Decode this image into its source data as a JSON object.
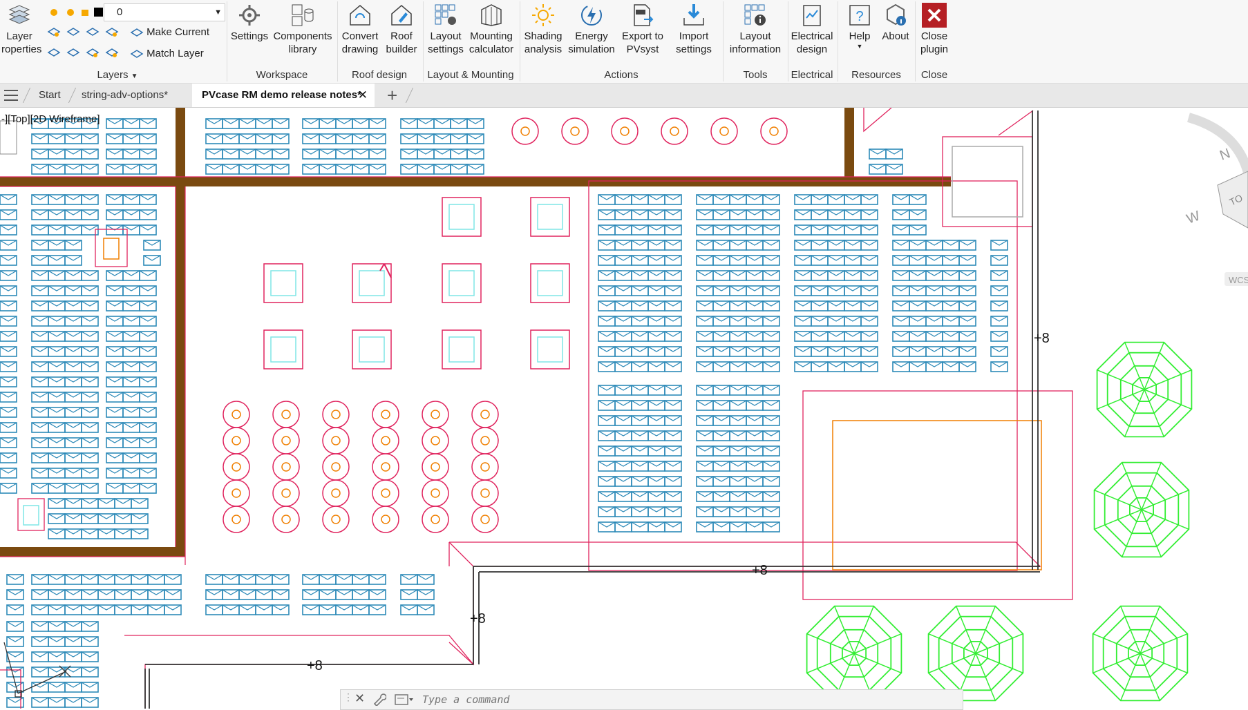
{
  "ribbon": {
    "layers": {
      "layer_properties": "Layer\nroperties",
      "current_layer": "0",
      "make_current": "Make Current",
      "match_layer": "Match Layer",
      "group_label": "Layers"
    },
    "workspace": {
      "settings": "Settings",
      "components_library": "Components\nlibrary",
      "group_label": "Workspace"
    },
    "roof_design": {
      "convert_drawing": "Convert\ndrawing",
      "roof_builder": "Roof\nbuilder",
      "group_label": "Roof design"
    },
    "layout_mounting": {
      "layout_settings": "Layout\nsettings",
      "mounting_calculator": "Mounting\ncalculator",
      "group_label": "Layout & Mounting"
    },
    "actions": {
      "shading_analysis": "Shading\nanalysis",
      "energy_simulation": "Energy\nsimulation",
      "export_to_pvsyst": "Export to\nPVsyst",
      "import_settings": "Import\nsettings",
      "group_label": "Actions"
    },
    "tools": {
      "layout_information": "Layout\ninformation",
      "group_label": "Tools"
    },
    "electrical": {
      "electrical_design": "Electrical\ndesign",
      "group_label": "Electrical"
    },
    "resources": {
      "help": "Help",
      "about": "About",
      "group_label": "Resources"
    },
    "close": {
      "close_plugin": "Close\nplugin",
      "group_label": "Close"
    }
  },
  "tabs": [
    {
      "label": "Start"
    },
    {
      "label": "string-adv-options*"
    },
    {
      "label": "PVcase RM demo release notes*",
      "active": true
    }
  ],
  "viewport": {
    "label": "-][Top][2D Wireframe]",
    "height_labels": [
      "+8",
      "+8",
      "+8",
      "+8"
    ],
    "viewcube": {
      "north": "N",
      "west": "W",
      "top": "TO",
      "wcs": "WCS"
    }
  },
  "command_line": {
    "placeholder": "Type a command"
  },
  "colors": {
    "module_blue": "#2d8ab8",
    "outline_red": "#e0245e",
    "ring_orange": "#f07f00",
    "tree_green": "#33ee33",
    "wall_brown": "#7a4a10",
    "obstacle_cyan": "#7fe6e6"
  }
}
